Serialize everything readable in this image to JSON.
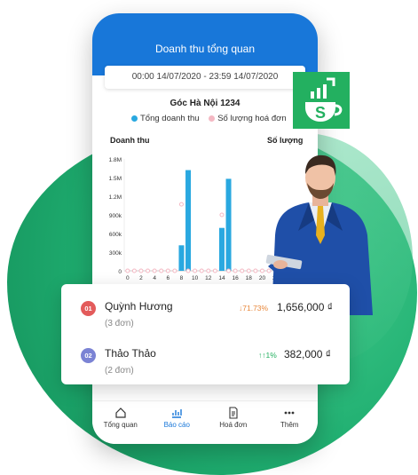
{
  "header": {
    "title": "Doanh thu tổng quan"
  },
  "date_range": "00:00 14/07/2020 - 23:59 14/07/2020",
  "store_name": "Góc Hà Nội 1234",
  "legend": {
    "revenue": "Tổng doanh thu",
    "invoices": "Số lượng hoá đơn"
  },
  "axes": {
    "left_title": "Doanh thu",
    "right_title": "Số lượng"
  },
  "colors": {
    "brand": "#1877d9",
    "bar": "#29a8e0",
    "dot": "#f4b8c3",
    "green": "#23b060",
    "rank1": "#e35b5b",
    "rank2": "#7b83d4"
  },
  "chart_data": {
    "type": "bar",
    "x": [
      0,
      1,
      2,
      3,
      4,
      5,
      6,
      7,
      8,
      9,
      10,
      11,
      12,
      13,
      14,
      15,
      16,
      17,
      18,
      19,
      20,
      21,
      22,
      23
    ],
    "xticks": [
      "0",
      "2",
      "4",
      "6",
      "8",
      "10",
      "12",
      "14",
      "16",
      "18",
      "20",
      "22"
    ],
    "yticks": [
      "0",
      "300k",
      "600k",
      "900k",
      "1.2M",
      "1.5M",
      "1.8M"
    ],
    "ylim": [
      0,
      1800000
    ],
    "series": [
      {
        "name": "Tổng doanh thu",
        "type": "bar",
        "values": [
          0,
          0,
          0,
          0,
          0,
          0,
          0,
          0,
          410000,
          1620000,
          0,
          0,
          0,
          0,
          690000,
          1480000,
          0,
          0,
          0,
          0,
          0,
          0,
          0,
          0
        ]
      },
      {
        "name": "Số lượng hoá đơn",
        "type": "dot",
        "values": [
          0,
          0,
          0,
          0,
          0,
          0,
          0,
          0,
          1070000,
          0,
          0,
          0,
          0,
          0,
          900000,
          0,
          0,
          0,
          0,
          0,
          0,
          0,
          0,
          0
        ]
      }
    ]
  },
  "ranking": [
    {
      "rank": "01",
      "name": "Quỳnh Hương",
      "orders": "(3 đơn)",
      "pct": "↓71.73%",
      "amount": "1,656,000 ₫"
    },
    {
      "rank": "02",
      "name": "Thảo Thảo",
      "orders": "(2 đơn)",
      "pct": "↑↑1%",
      "amount": "382,000 ₫"
    }
  ],
  "nav": [
    {
      "label": "Tổng quan",
      "icon": "home-icon"
    },
    {
      "label": "Báo cáo",
      "icon": "chart-icon"
    },
    {
      "label": "Hoá đơn",
      "icon": "invoice-icon"
    },
    {
      "label": "Thêm",
      "icon": "more-icon"
    }
  ],
  "logo": {
    "letter": "S",
    "icon": "coffee-cup-logo"
  }
}
